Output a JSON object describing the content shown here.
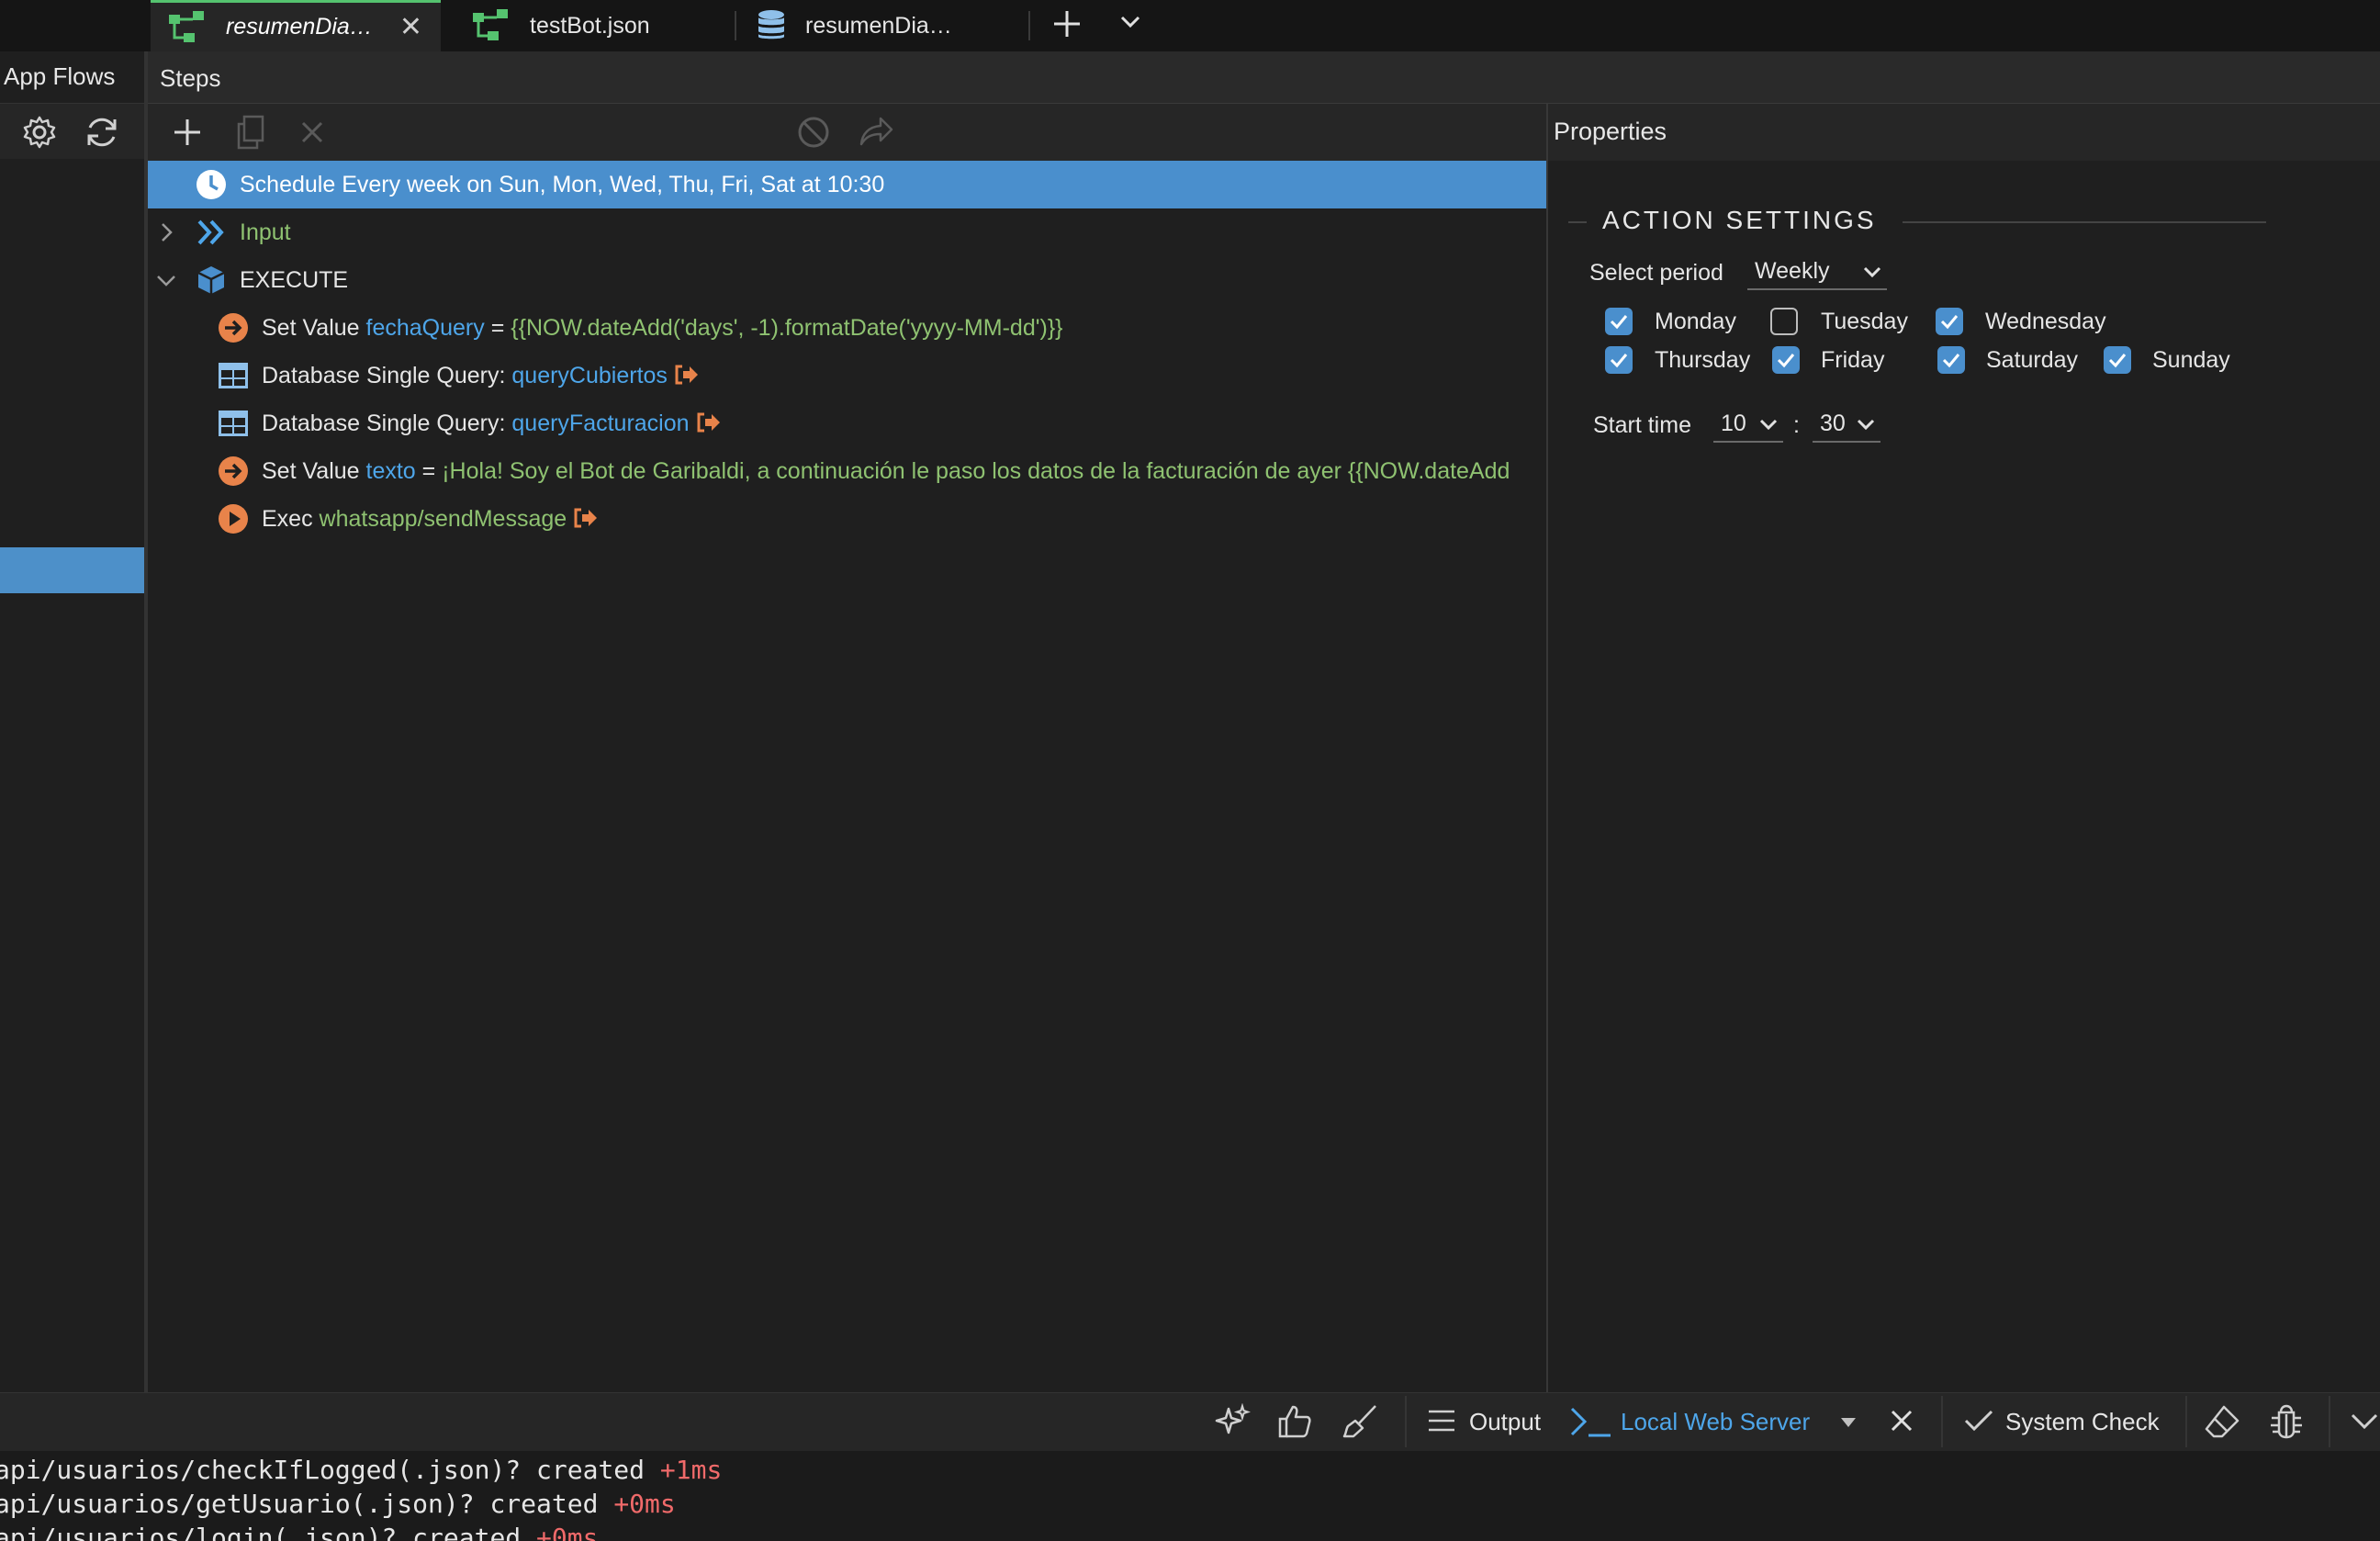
{
  "tabs": [
    {
      "label": "resumenDia…",
      "icon": "flow-icon",
      "active": true,
      "closable": true
    },
    {
      "label": "testBot.json",
      "icon": "flow-icon",
      "active": false,
      "closable": false
    },
    {
      "label": "resumenDia…",
      "icon": "database-icon",
      "active": false,
      "closable": false
    }
  ],
  "sidebar": {
    "title": "App Flows"
  },
  "steps_panel": {
    "title": "Steps",
    "rows": [
      {
        "type": "schedule",
        "text": "Schedule Every week on Sun, Mon, Wed, Thu, Fri, Sat at 10:30",
        "selected": true
      },
      {
        "type": "group",
        "label": "Input",
        "expanded": false
      },
      {
        "type": "group",
        "label": "EXECUTE",
        "expanded": true
      },
      {
        "type": "set_value",
        "prefix": "Set Value",
        "variable": "fechaQuery",
        "op": "=",
        "value": "{{NOW.dateAdd('days', -1).formatDate('yyyy-MM-dd')}}"
      },
      {
        "type": "db_query",
        "prefix": "Database Single Query:",
        "target": "queryCubiertos"
      },
      {
        "type": "db_query",
        "prefix": "Database Single Query:",
        "target": "queryFacturacion"
      },
      {
        "type": "set_value",
        "prefix": "Set Value",
        "variable": "texto",
        "op": "=",
        "value": "¡Hola! Soy el Bot de Garibaldi, a continuación le paso los datos de la facturación de ayer {{NOW.dateAdd"
      },
      {
        "type": "exec",
        "prefix": "Exec",
        "target": "whatsapp/sendMessage"
      }
    ]
  },
  "properties": {
    "title": "Properties",
    "section_title": "ACTION SETTINGS",
    "period_label": "Select period",
    "period_value": "Weekly",
    "days": [
      {
        "label": "Monday",
        "checked": true
      },
      {
        "label": "Tuesday",
        "checked": false
      },
      {
        "label": "Wednesday",
        "checked": true
      },
      {
        "label": "Thursday",
        "checked": true
      },
      {
        "label": "Friday",
        "checked": true
      },
      {
        "label": "Saturday",
        "checked": true
      },
      {
        "label": "Sunday",
        "checked": true
      }
    ],
    "start_time_label": "Start time",
    "hour": "10",
    "minute": "30",
    "time_separator": ":"
  },
  "bottom_bar": {
    "output_label": "Output",
    "server_label": "Local Web Server",
    "system_check_label": "System Check"
  },
  "console": [
    {
      "text": "api/usuarios/checkIfLogged(.json)? created",
      "dur": "+1ms"
    },
    {
      "text": "api/usuarios/getUsuario(.json)? created",
      "dur": "+0ms"
    },
    {
      "text": "api/usuarios/login(.json)? created",
      "dur": "+0ms"
    }
  ],
  "colors": {
    "accent": "#4a8fcd",
    "link": "#4ea6ea",
    "string": "#8fc271",
    "icon_orange": "#e8834a",
    "log_duration": "#f06a6a"
  }
}
